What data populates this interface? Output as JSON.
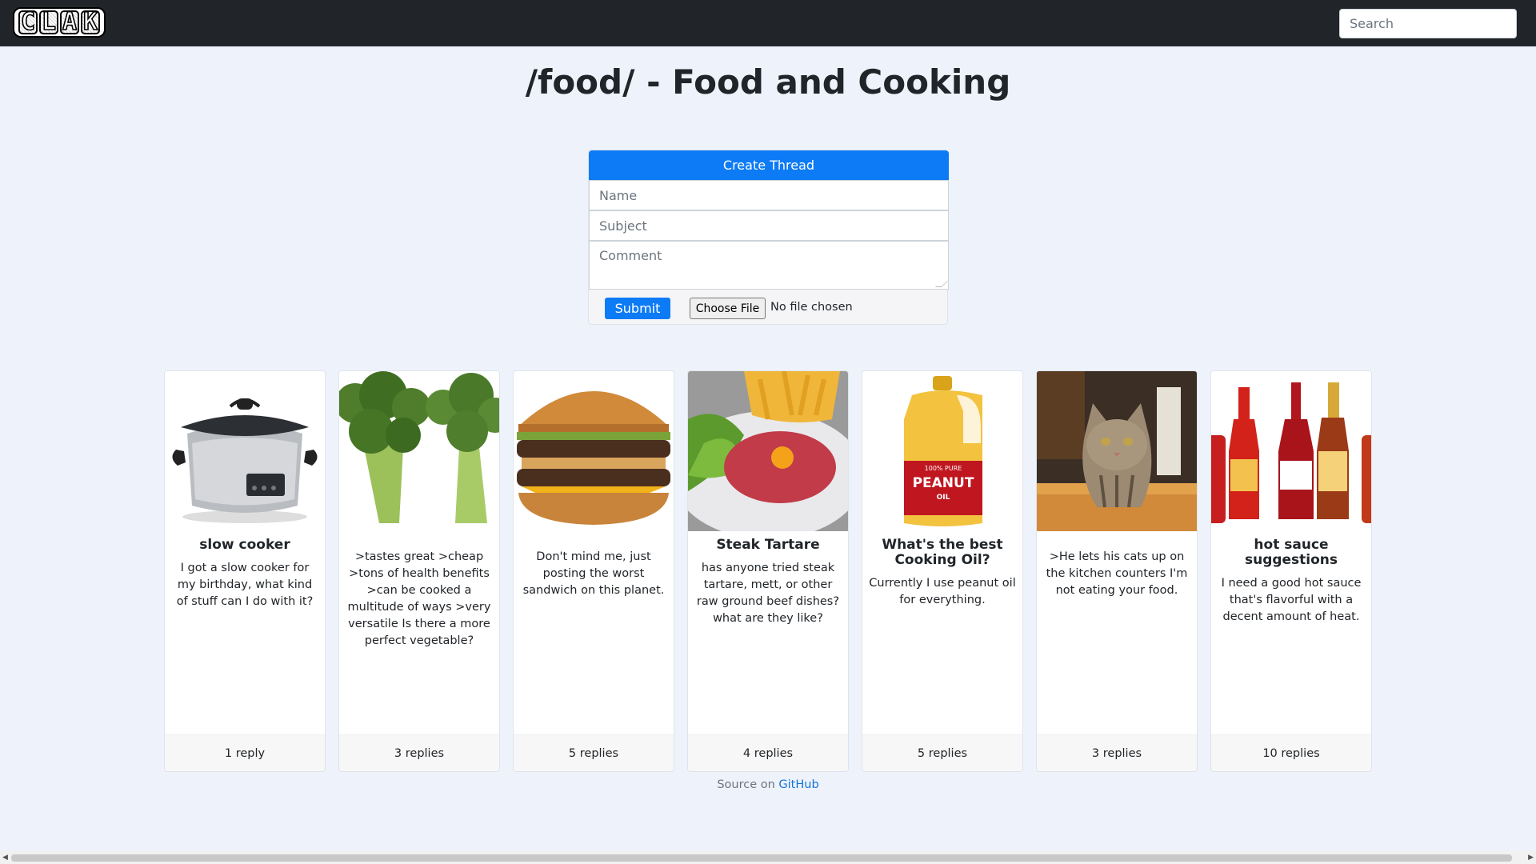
{
  "header": {
    "logo_letters": [
      "C",
      "L",
      "A",
      "K"
    ],
    "search_placeholder": "Search"
  },
  "page_title": "/food/ - Food and Cooking",
  "form": {
    "create_label": "Create Thread",
    "name_placeholder": "Name",
    "subject_placeholder": "Subject",
    "comment_placeholder": "Comment",
    "submit_label": "Submit",
    "file_button_label": "Choose File",
    "file_status": "No file chosen"
  },
  "threads": [
    {
      "title": "slow cooker",
      "text": "I got a slow cooker for my birthday, what kind of stuff can I do with it?",
      "replies": "1 reply",
      "image_icon": "slow-cooker"
    },
    {
      "title": "",
      "text": ">tastes great >cheap >tons of health benefits >can be cooked a multitude of ways >very versatile Is there a more perfect vegetable?",
      "replies": "3 replies",
      "image_icon": "broccoli"
    },
    {
      "title": "",
      "text": "Don't mind me, just posting the worst sandwich on this planet.",
      "replies": "5 replies",
      "image_icon": "hamburger"
    },
    {
      "title": "Steak Tartare",
      "text": "has anyone tried steak tartare, mett, or other raw ground beef dishes? what are they like?",
      "replies": "4 replies",
      "image_icon": "steak-tartare"
    },
    {
      "title": "What's the best Cooking Oil?",
      "text": "Currently I use peanut oil for everything.",
      "replies": "5 replies",
      "image_icon": "peanut-oil-jug",
      "image_label_top": "100% PURE",
      "image_label_main": "PEANUT",
      "image_label_bottom": "OIL"
    },
    {
      "title": "",
      "text": ">He lets his cats up on the kitchen counters I'm not eating your food.",
      "replies": "3 replies",
      "image_icon": "cat"
    },
    {
      "title": "hot sauce suggestions",
      "text": "I need a good hot sauce that's flavorful with a decent amount of heat.",
      "replies": "10 replies",
      "image_icon": "hot-sauce-bottles"
    }
  ],
  "footer": {
    "source_prefix": "Source on",
    "source_link": "GitHub"
  },
  "colors": {
    "navbar": "#212529",
    "primary": "#0d7bf5",
    "background": "#eef2fb"
  }
}
